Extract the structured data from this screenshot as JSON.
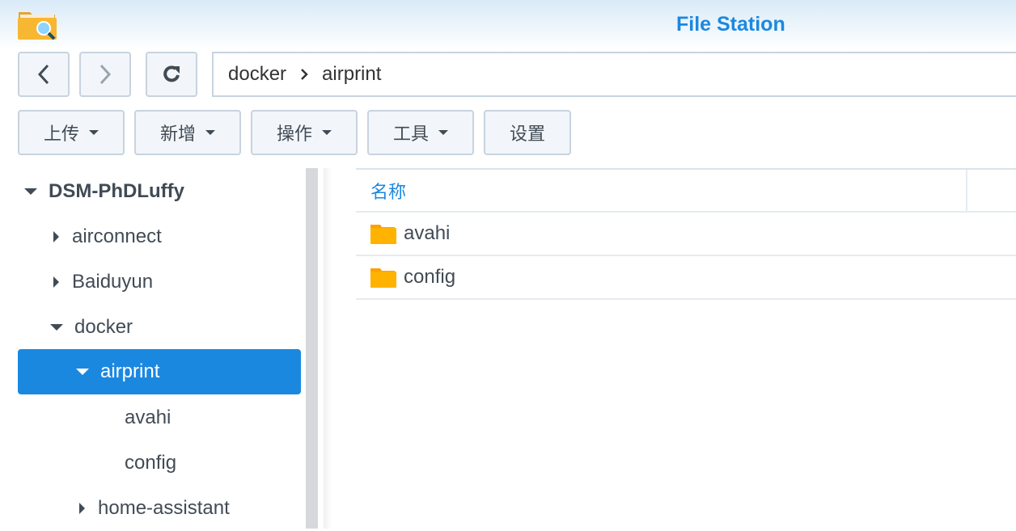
{
  "app": {
    "title": "File Station",
    "icon": "file-station-folder-search-icon"
  },
  "nav": {
    "back": "chevron-left-icon",
    "forward": "chevron-right-icon",
    "refresh": "refresh-icon"
  },
  "path": {
    "segments": [
      "docker",
      "airprint"
    ]
  },
  "toolbar": {
    "upload": "上传",
    "create": "新增",
    "action": "操作",
    "tools": "工具",
    "settings": "设置"
  },
  "tree": {
    "root": "DSM-PhDLuffy",
    "items": [
      "airconnect",
      "Baiduyun",
      "docker",
      "airprint",
      "avahi",
      "config",
      "home-assistant"
    ],
    "selected": "airprint"
  },
  "list": {
    "columns": [
      "名称"
    ],
    "rows": [
      {
        "name": "avahi",
        "type": "folder"
      },
      {
        "name": "config",
        "type": "folder"
      }
    ]
  },
  "colors": {
    "accent": "#1b88e0",
    "folder": "#ffb300"
  }
}
